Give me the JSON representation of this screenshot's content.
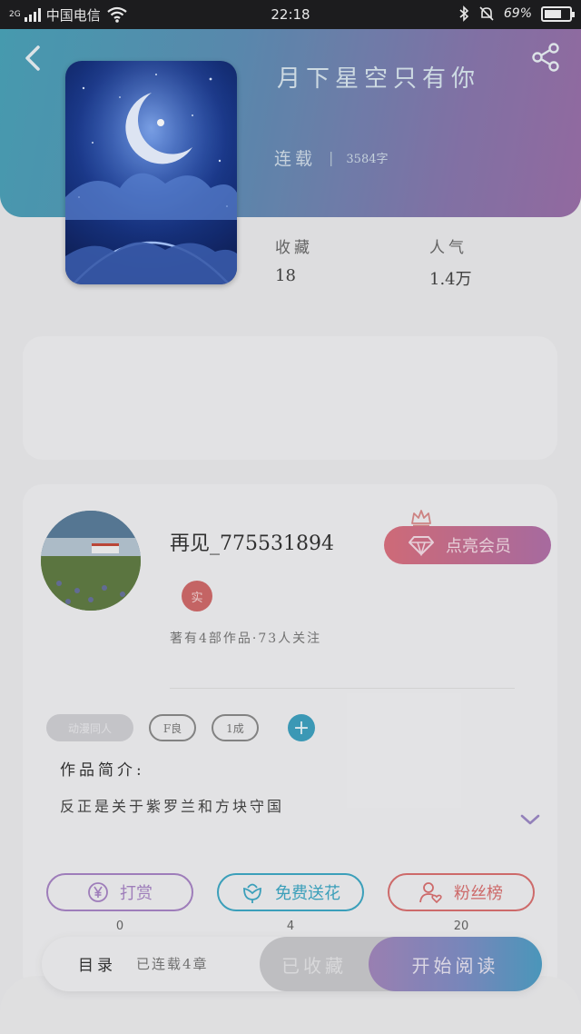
{
  "status_bar": {
    "network": "2G",
    "carrier": "中国电信",
    "time": "22:18",
    "battery": "69%",
    "battery_level": 0.69
  },
  "book": {
    "title": "月下星空只有你",
    "status": "连载",
    "separator": "|",
    "word_count": "3584字"
  },
  "stats": {
    "favorites_label": "收藏",
    "favorites_value": "18",
    "popularity_label": "人气",
    "popularity_value": "1.4万"
  },
  "author": {
    "name": "再见_775531894",
    "badge": "实",
    "meta": "著有4部作品·73人关注",
    "vip_label": "点亮会员"
  },
  "tags": [
    "动漫同人",
    "F良",
    "1成"
  ],
  "intro": {
    "title": "作品简介:",
    "text": "反正是关于紫罗兰和方块守国"
  },
  "actions": {
    "reward_label": "打赏",
    "reward_count": "0",
    "flower_label": "免费送花",
    "flower_count": "4",
    "fans_label": "粉丝榜",
    "fans_count": "20"
  },
  "bottom": {
    "toc_label": "目录",
    "toc_sub": "已连载4章",
    "collected_label": "已收藏",
    "read_label": "开始阅读"
  },
  "colors": {
    "reward": "#a784c4",
    "flower": "#3fa8c4",
    "fans": "#d87070"
  }
}
